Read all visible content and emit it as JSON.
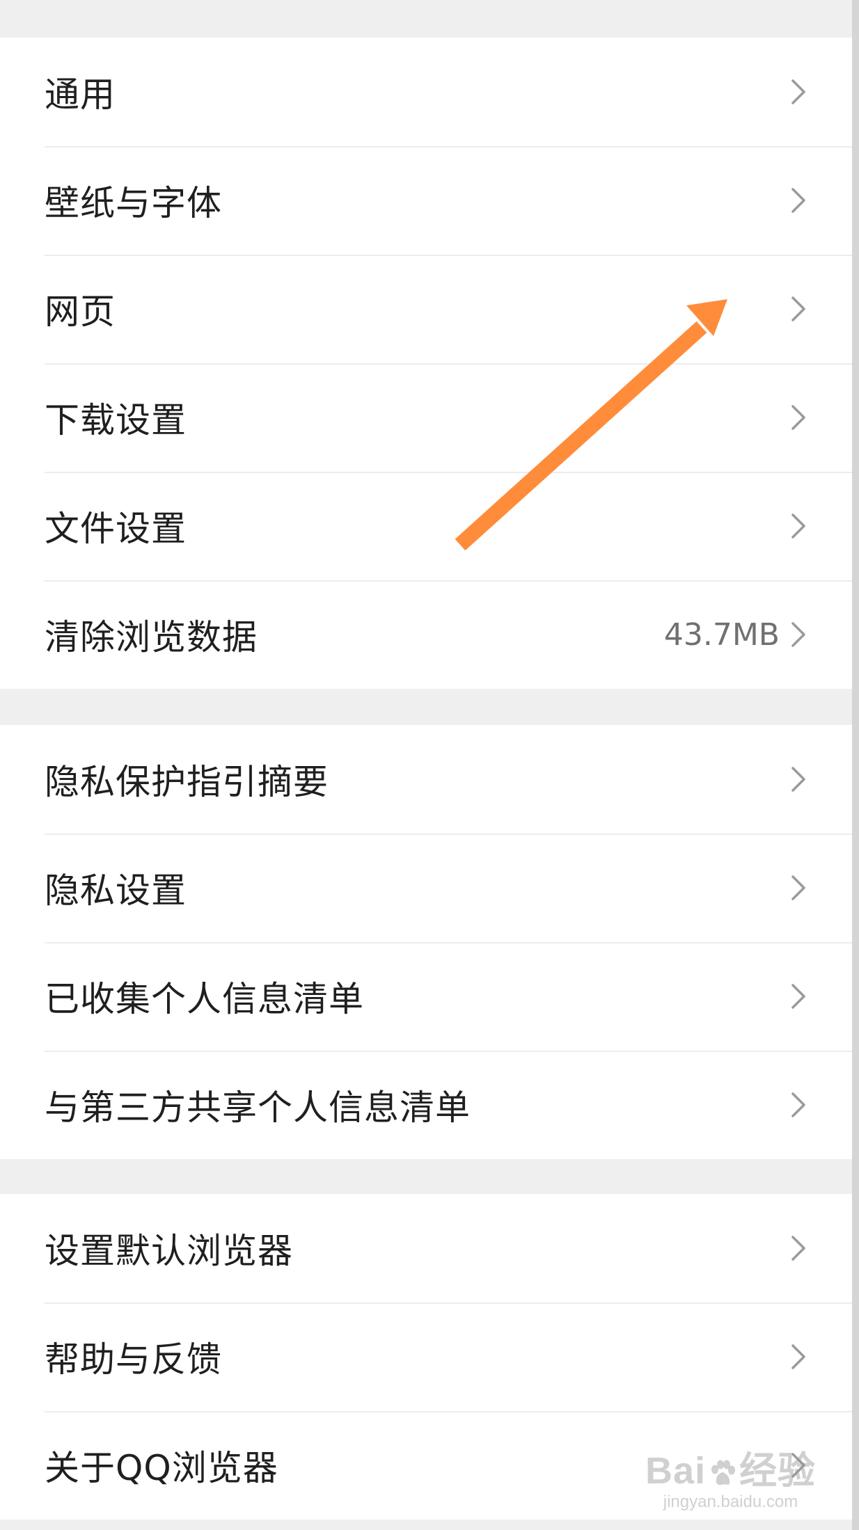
{
  "groups": [
    {
      "items": [
        {
          "label": "通用"
        },
        {
          "label": "壁纸与字体"
        },
        {
          "label": "网页"
        },
        {
          "label": "下载设置"
        },
        {
          "label": "文件设置"
        },
        {
          "label": "清除浏览数据",
          "value": "43.7MB"
        }
      ]
    },
    {
      "items": [
        {
          "label": "隐私保护指引摘要"
        },
        {
          "label": "隐私设置"
        },
        {
          "label": "已收集个人信息清单"
        },
        {
          "label": "与第三方共享个人信息清单"
        }
      ]
    },
    {
      "items": [
        {
          "label": "设置默认浏览器"
        },
        {
          "label": "帮助与反馈"
        },
        {
          "label": "关于QQ浏览器"
        }
      ]
    }
  ],
  "icons": {
    "row_chevron": "chevron-right-icon",
    "annotation": "orange-arrow-icon"
  },
  "colors": {
    "background": "#efefef",
    "row_background": "#ffffff",
    "text": "#1f1f1f",
    "secondary_text": "#707070",
    "chevron": "#9a9a9a",
    "annotation_arrow": "#ff8c3a"
  },
  "watermark": {
    "brand_left": "Bai",
    "brand_right": "经验",
    "site": "jingyan.baidu.com"
  }
}
